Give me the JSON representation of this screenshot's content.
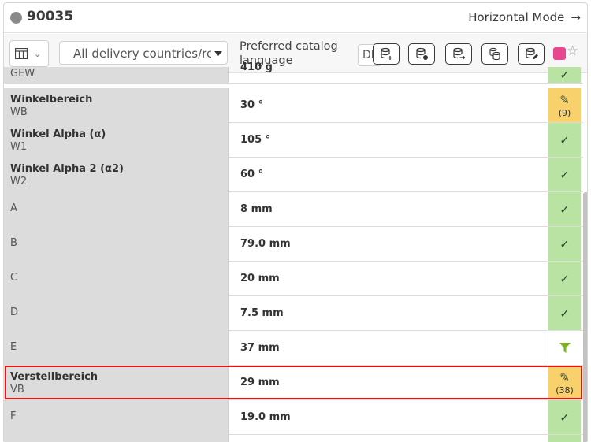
{
  "header": {
    "item_id": "90035",
    "mode_link": "Horizontal Mode"
  },
  "toolbar": {
    "country_select": "All delivery countries/regions",
    "language_label": "Preferred catalog language",
    "language_value": "DE"
  },
  "rows": [
    {
      "name": "GEW",
      "value": "410 g",
      "status": "ok"
    },
    {
      "name": "Winkelbereich",
      "code": "WB",
      "value": "30 °",
      "status": "edit",
      "count": "(9)"
    },
    {
      "name": "Winkel Alpha (α)",
      "code": "W1",
      "value": "105 °",
      "status": "ok"
    },
    {
      "name": "Winkel Alpha 2 (α2)",
      "code": "W2",
      "value": "60 °",
      "status": "ok"
    },
    {
      "name": "A",
      "value": "8 mm",
      "status": "ok"
    },
    {
      "name": "B",
      "value": "79.0 mm",
      "status": "ok"
    },
    {
      "name": "C",
      "value": "20 mm",
      "status": "ok"
    },
    {
      "name": "D",
      "value": "7.5 mm",
      "status": "ok"
    },
    {
      "name": "E",
      "value": "37 mm",
      "status": "filter"
    },
    {
      "name": "Verstellbereich",
      "code": "VB",
      "value": "29 mm",
      "status": "edit",
      "count": "(38)"
    },
    {
      "name": "F",
      "value": "19.0 mm",
      "status": "ok"
    }
  ],
  "icons": {
    "status_ok": "check-icon",
    "status_edit": "pencil-icon",
    "status_filter": "filter-icon",
    "toolbar": [
      "database-add-icon",
      "database-remove-icon",
      "database-export-icon",
      "database-copy-icon",
      "database-edit-icon",
      "pin-icon",
      "star-icon"
    ]
  },
  "colors": {
    "ok": "#b9e3a3",
    "edit": "#f8d06c",
    "highlight": "#e01616",
    "filter": "#7bb31b"
  }
}
